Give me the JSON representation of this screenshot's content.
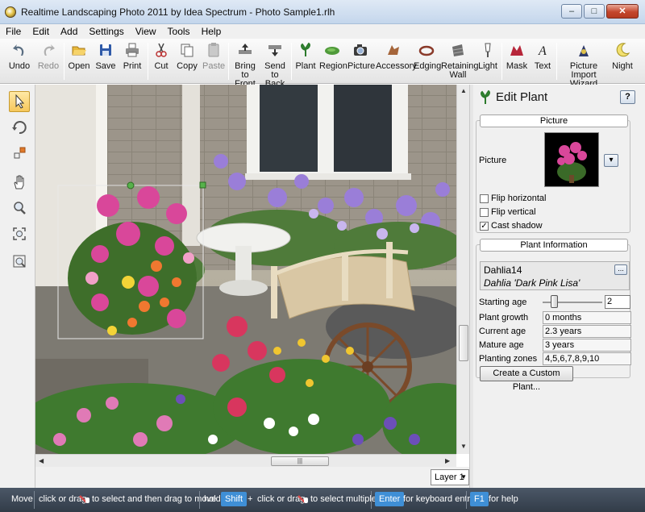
{
  "window": {
    "title": "Realtime Landscaping Photo 2011 by Idea Spectrum - Photo Sample1.rlh",
    "controls": {
      "minimize": "–",
      "maximize": "□",
      "close": "✕"
    }
  },
  "menu": [
    "File",
    "Edit",
    "Add",
    "Settings",
    "View",
    "Tools",
    "Help"
  ],
  "toolbar": [
    {
      "label": "Undo",
      "icon": "undo-icon",
      "enabled": true
    },
    {
      "label": "Redo",
      "icon": "redo-icon",
      "enabled": false
    },
    {
      "label": "Open",
      "icon": "open-folder-icon",
      "enabled": true
    },
    {
      "label": "Save",
      "icon": "floppy-disk-icon",
      "enabled": true
    },
    {
      "label": "Print",
      "icon": "printer-icon",
      "enabled": true
    },
    {
      "label": "Cut",
      "icon": "scissors-icon",
      "enabled": true
    },
    {
      "label": "Copy",
      "icon": "copy-icon",
      "enabled": true
    },
    {
      "label": "Paste",
      "icon": "paste-icon",
      "enabled": false
    },
    {
      "label": "Bring to Front",
      "icon": "bring-to-front-icon",
      "enabled": true
    },
    {
      "label": "Send to Back",
      "icon": "send-to-back-icon",
      "enabled": true
    },
    {
      "label": "Plant",
      "icon": "plant-icon",
      "enabled": true
    },
    {
      "label": "Region",
      "icon": "region-icon",
      "enabled": true
    },
    {
      "label": "Picture",
      "icon": "camera-icon",
      "enabled": true
    },
    {
      "label": "Accessory",
      "icon": "accessory-icon",
      "enabled": true
    },
    {
      "label": "Edging",
      "icon": "edging-icon",
      "enabled": true
    },
    {
      "label": "Retaining Wall",
      "icon": "retaining-wall-icon",
      "enabled": true
    },
    {
      "label": "Light",
      "icon": "light-icon",
      "enabled": true
    },
    {
      "label": "Mask",
      "icon": "mask-icon",
      "enabled": true
    },
    {
      "label": "Text",
      "icon": "text-icon",
      "enabled": true
    },
    {
      "label": "Picture Import Wizard",
      "icon": "import-wizard-icon",
      "enabled": true
    },
    {
      "label": "Night",
      "icon": "moon-icon",
      "enabled": true
    }
  ],
  "tools": [
    {
      "name": "select-tool",
      "icon": "arrow-pointer-icon",
      "active": true
    },
    {
      "name": "rotate-tool",
      "icon": "rotate-icon",
      "active": false
    },
    {
      "name": "resize-tool",
      "icon": "resize-icon",
      "active": false
    },
    {
      "name": "pan-tool",
      "icon": "hand-icon",
      "active": false
    },
    {
      "name": "zoom-tool",
      "icon": "magnifier-icon",
      "active": false
    },
    {
      "name": "zoom-extents-tool",
      "icon": "zoom-extents-icon",
      "active": false
    },
    {
      "name": "zoom-window-tool",
      "icon": "zoom-window-icon",
      "active": false
    }
  ],
  "canvas": {
    "description_visible": false
  },
  "layer": {
    "selected": "Layer 1"
  },
  "hscroll_grip": "|||",
  "panel": {
    "title": "Edit Plant",
    "help": "?",
    "picture_group": {
      "caption": "Picture",
      "picture_label": "Picture",
      "dropdown": "▾",
      "flip_horizontal": {
        "label": "Flip horizontal",
        "checked": false
      },
      "flip_vertical": {
        "label": "Flip vertical",
        "checked": false
      },
      "cast_shadow": {
        "label": "Cast shadow",
        "checked": true
      }
    },
    "info_group": {
      "caption": "Plant Information",
      "plant_name": "Dahlia14",
      "plant_species": "Dahlia 'Dark Pink Lisa'",
      "browse": "...",
      "starting_age_label": "Starting age",
      "starting_age_value": "2",
      "plant_growth_label": "Plant growth",
      "plant_growth_value": "0 months",
      "current_age_label": "Current age",
      "current_age_value": "2.3 years",
      "mature_age_label": "Mature age",
      "mature_age_value": "3 years",
      "planting_zones_label": "Planting zones",
      "planting_zones_value": "4,5,6,7,8,9,10",
      "custom_button": "Create a Custom Plant..."
    }
  },
  "status": {
    "move": "Move",
    "click_or_drag_1": "click or drag",
    "to_select_move": "to select and then drag to move",
    "hold": "hold",
    "shift": "Shift",
    "plus": "+",
    "click_or_drag_2": "click or drag",
    "to_select_multiple": "to select multiple",
    "enter": "Enter",
    "keyboard_entry": "for keyboard entry",
    "f1": "F1",
    "for_help": "for help"
  },
  "colors": {
    "key_badge": "#3f8fd6",
    "status_bg": "#3a4451",
    "active_tool": "#f6c75b",
    "selection_handle": "#4caf50"
  }
}
